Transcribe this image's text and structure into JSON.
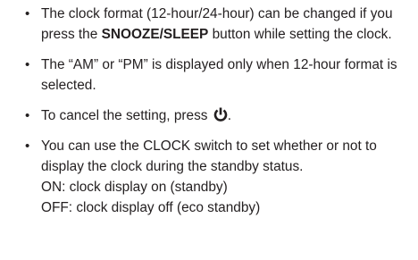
{
  "notes": {
    "bullet_glyph": "•",
    "item1": {
      "text_before": "The clock format (12-hour/24-hour) can be changed if you press the ",
      "button_label": "SNOOZE/SLEEP",
      "text_after": " button while setting the clock."
    },
    "item2": {
      "text": "The “AM” or “PM” is displayed only when 12-hour format is selected."
    },
    "item3": {
      "text_before": "To cancel the setting, press ",
      "icon": "power-icon",
      "text_after": "."
    },
    "item4": {
      "text": "You can use the CLOCK switch to set whether or not to display the clock during the standby status.",
      "on_line": "ON: clock display on (standby)",
      "off_line": "OFF: clock display off (eco standby)"
    }
  }
}
